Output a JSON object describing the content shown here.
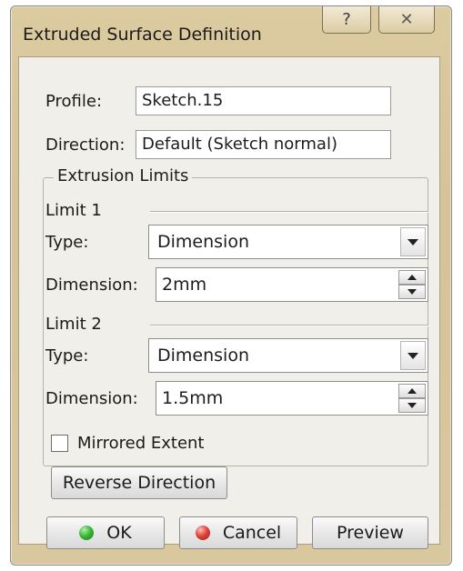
{
  "window": {
    "title": "Extruded Surface Definition",
    "help_icon": "question-mark-icon",
    "close_icon": "close-x-icon"
  },
  "profile": {
    "label": "Profile:",
    "value": "Sketch.15"
  },
  "direction": {
    "label": "Direction:",
    "value": "Default (Sketch normal)"
  },
  "extrusion_limits": {
    "title": "Extrusion Limits",
    "limit1": {
      "title": "Limit 1",
      "type_label": "Type:",
      "type_value": "Dimension",
      "dimension_label": "Dimension:",
      "dimension_value": "2mm"
    },
    "limit2": {
      "title": "Limit 2",
      "type_label": "Type:",
      "type_value": "Dimension",
      "dimension_label": "Dimension:",
      "dimension_value": "1.5mm"
    }
  },
  "mirrored_extent": {
    "label": "Mirrored Extent",
    "checked": false
  },
  "reverse_direction": {
    "label": "Reverse Direction"
  },
  "buttons": {
    "ok": "OK",
    "cancel": "Cancel",
    "preview": "Preview"
  },
  "colors": {
    "frame": "#d8c79c",
    "client": "#f0efe9",
    "ok_dot": "#3bb83a",
    "cancel_dot": "#e0453a"
  }
}
